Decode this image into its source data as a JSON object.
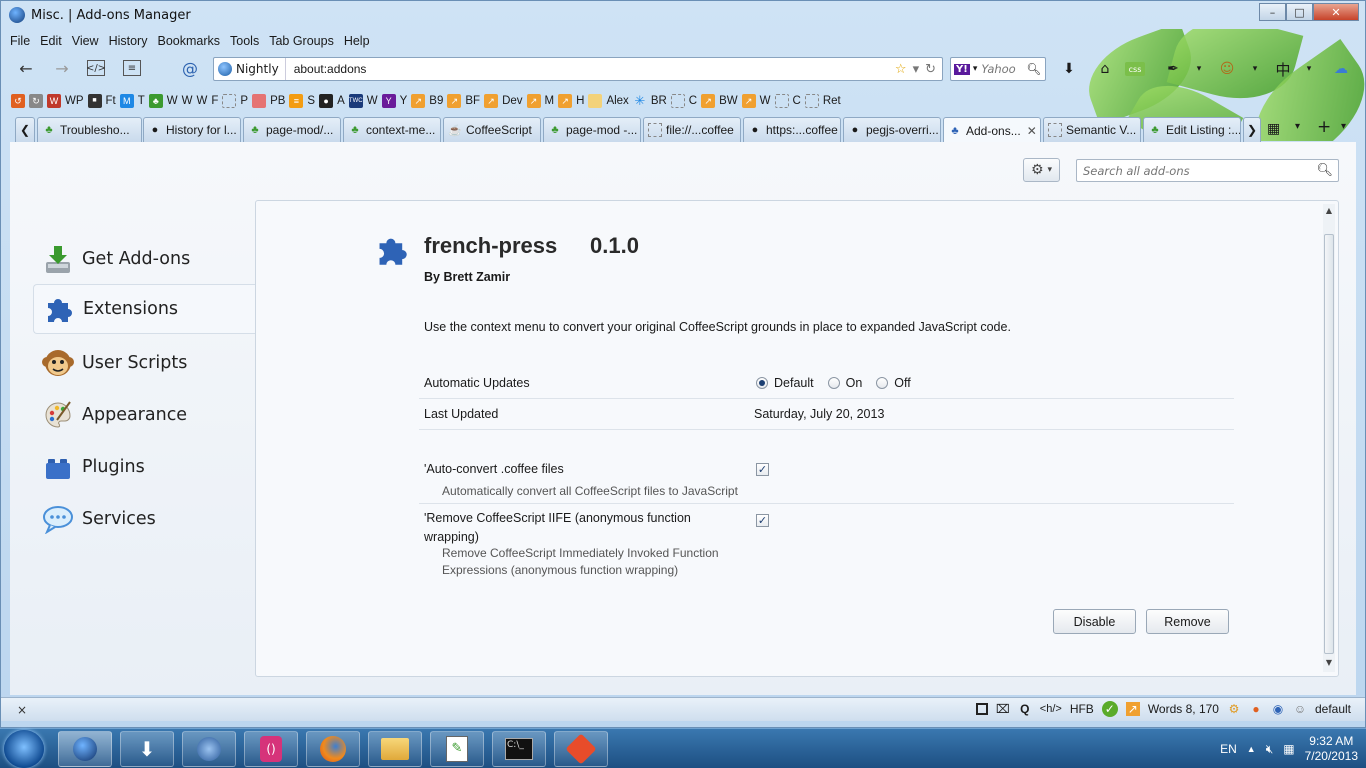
{
  "window": {
    "title": "Misc. | Add-ons Manager",
    "minimize": "–",
    "maximize": "□",
    "close": "✕"
  },
  "menubar": [
    "File",
    "Edit",
    "View",
    "History",
    "Bookmarks",
    "Tools",
    "Tab Groups",
    "Help"
  ],
  "navbar": {
    "identity_label": "Nightly",
    "url": "about:addons",
    "search_placeholder": "Yahoo",
    "search_engine_badge": "Y!"
  },
  "bookmarks": [
    "WP",
    "Ft",
    "T",
    "W",
    "W",
    "W",
    "F",
    "P",
    "PB",
    "S",
    "A",
    "W",
    "Y",
    "B9",
    "BF",
    "Dev",
    "M",
    "H",
    "Alex",
    "BR",
    "C",
    "BW",
    "W",
    "C",
    "Ret"
  ],
  "tabs": [
    {
      "label": "Troublesho...",
      "icon": "puzzle-icon",
      "active": false
    },
    {
      "label": "History for l...",
      "icon": "github-icon",
      "active": false
    },
    {
      "label": "page-mod/...",
      "icon": "puzzle-icon",
      "active": false
    },
    {
      "label": "context-me...",
      "icon": "puzzle-icon",
      "active": false
    },
    {
      "label": "CoffeeScript",
      "icon": "coffee-icon",
      "active": false
    },
    {
      "label": "page-mod -...",
      "icon": "puzzle-icon",
      "active": false
    },
    {
      "label": "file://...coffee",
      "icon": "blank-page-icon",
      "active": false
    },
    {
      "label": "https:...coffee",
      "icon": "github-icon",
      "active": false
    },
    {
      "label": "pegjs-overri...",
      "icon": "github-icon",
      "active": false
    },
    {
      "label": "Add-ons...",
      "icon": "puzzle-icon",
      "active": true
    },
    {
      "label": "Semantic V...",
      "icon": "blank-page-icon",
      "active": false
    },
    {
      "label": "Edit Listing :...",
      "icon": "puzzle-icon",
      "active": false
    }
  ],
  "addons_manager": {
    "search_placeholder": "Search all add-ons",
    "categories": [
      {
        "label": "Get Add-ons",
        "icon": "download-icon",
        "selected": false
      },
      {
        "label": "Extensions",
        "icon": "puzzle-icon",
        "selected": true
      },
      {
        "label": "User Scripts",
        "icon": "monkey-icon",
        "selected": false
      },
      {
        "label": "Appearance",
        "icon": "palette-icon",
        "selected": false
      },
      {
        "label": "Plugins",
        "icon": "lego-icon",
        "selected": false
      },
      {
        "label": "Services",
        "icon": "chat-bubble-icon",
        "selected": false
      }
    ],
    "detail": {
      "name": "french-press",
      "version": "0.1.0",
      "author": "By Brett Zamir",
      "description": "Use the context menu to convert your original CoffeeScript grounds in place to expanded JavaScript code.",
      "automatic_updates_label": "Automatic Updates",
      "update_options": [
        "Default",
        "On",
        "Off"
      ],
      "update_selected": "Default",
      "last_updated_label": "Last Updated",
      "last_updated_value": "Saturday, July 20, 2013",
      "prefs": [
        {
          "label": "'Auto-convert .coffee files",
          "description": "Automatically convert all CoffeeScript files to JavaScript",
          "checked": true
        },
        {
          "label": "'Remove CoffeeScript IIFE (anonymous function wrapping)",
          "description": "Remove CoffeeScript Immediately Invoked Function Expressions (anonymous function wrapping)",
          "checked": true
        }
      ],
      "disable_button": "Disable",
      "remove_button": "Remove"
    }
  },
  "addon_bar": {
    "close": "×",
    "items": [
      "HFB",
      "Words 8, 170",
      "default"
    ],
    "hbar": "<h/>"
  },
  "taskbar": {
    "language": "EN",
    "time": "9:32 AM",
    "date": "7/20/2013"
  },
  "colors": {
    "accent": "#1c3f73",
    "leaf_green": "#5cb82f",
    "taskbar": "#2a6fa8"
  }
}
